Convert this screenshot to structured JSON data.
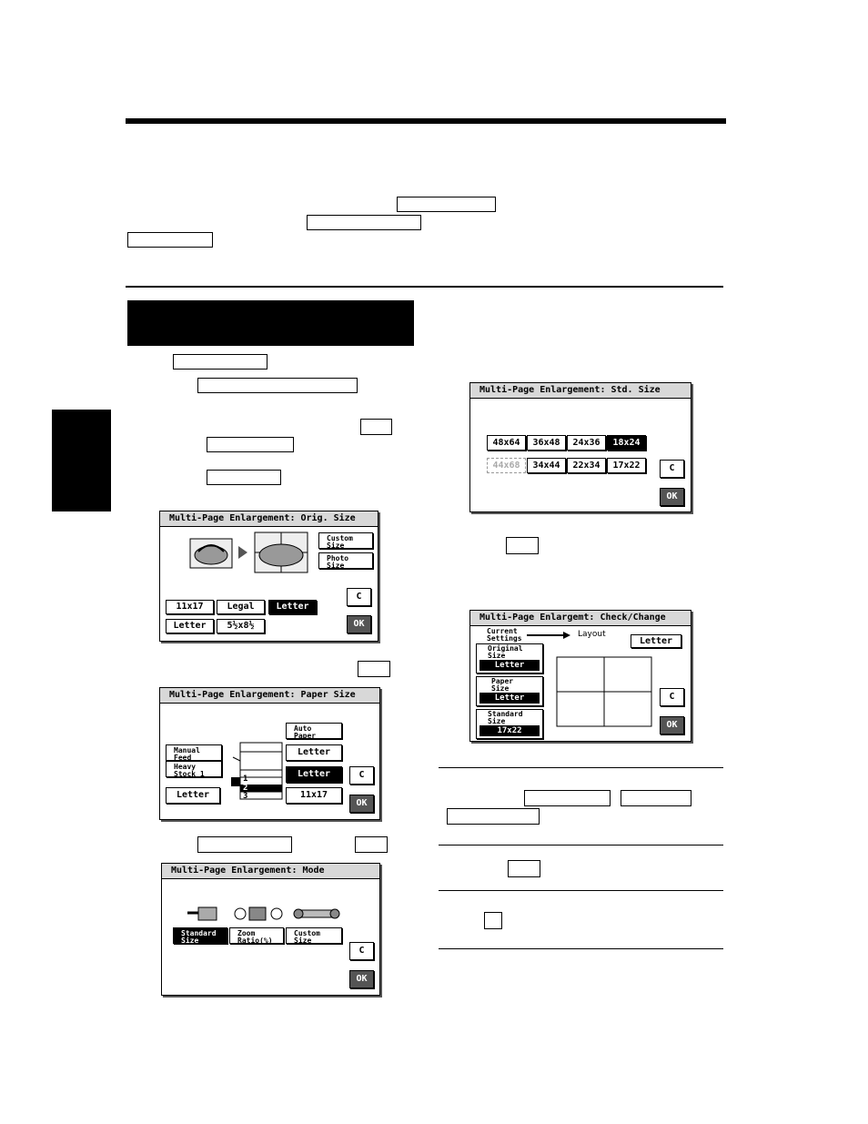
{
  "orig_size_panel": {
    "title": "Multi-Page Enlargement: Orig. Size",
    "custom_size": "Custom\nSize",
    "photo_size": "Photo\nSize",
    "sizes": [
      "11x17",
      "Legal",
      "Letter",
      "Letter",
      "5½x8½"
    ],
    "c": "C",
    "ok": "OK"
  },
  "paper_size_panel": {
    "title": "Multi-Page Enlargement: Paper Size",
    "auto_paper": "Auto\nPaper",
    "manual_feed": "Manual\nFeed",
    "heavy_stock": "Heavy\nStock 1",
    "letter_l": "Letter",
    "tray1": "Letter",
    "tray2": "Letter",
    "tray3": "11x17",
    "tray_numbers": [
      "1",
      "2",
      "3"
    ],
    "c": "C",
    "ok": "OK"
  },
  "mode_panel": {
    "title": "Multi-Page Enlargement: Mode",
    "standard_size": "Standard\nSize",
    "zoom_ratio": "Zoom\nRatio(%)",
    "custom_size": "Custom\nSize",
    "c": "C",
    "ok": "OK"
  },
  "std_size_panel": {
    "title": "Multi-Page Enlargement: Std. Size",
    "row1": [
      "48x64",
      "36x48",
      "24x36",
      "18x24"
    ],
    "row2": [
      "44x68",
      "34x44",
      "22x34",
      "17x22"
    ],
    "c": "C",
    "ok": "OK"
  },
  "check_panel": {
    "title": "Multi-Page Enlargemt: Check/Change",
    "current_settings": "Current\nSettings",
    "layout": "Layout",
    "original_size": "Original\nSize",
    "original_val": "Letter",
    "paper_size": "Paper\nSize",
    "paper_val": "Letter",
    "standard_size": "Standard\nSize",
    "standard_val": "17x22",
    "layout_paper": "Letter",
    "c": "C",
    "ok": "OK"
  }
}
